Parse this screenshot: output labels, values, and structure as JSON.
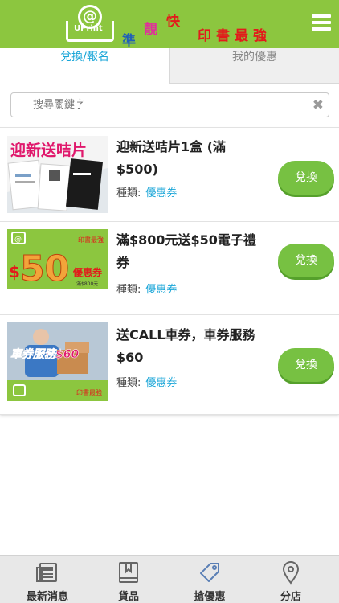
{
  "header": {
    "logo_text": "UPrint",
    "slogan": [
      "準",
      "靚",
      "快",
      "印書最強"
    ]
  },
  "tabs": [
    {
      "label": "兌換/報名",
      "active": true
    },
    {
      "label": "我的優惠",
      "active": false
    }
  ],
  "search": {
    "placeholder": "搜尋關鍵字",
    "value": ""
  },
  "offers": [
    {
      "title": "迎新送咭片1盒 (滿$500)",
      "type_label": "種類:",
      "type_value": "優惠券",
      "button": "兌換",
      "image_text": "迎新送咭片"
    },
    {
      "title": "滿$800元送$50電子禮券",
      "type_label": "種類:",
      "type_value": "優惠券",
      "button": "兌換",
      "image_text": {
        "amount": "$50",
        "label": "優惠券",
        "note": "滿$800元",
        "slogan": "印書最強"
      }
    },
    {
      "title": "送CALL車券，車券服務$60",
      "type_label": "種類:",
      "type_value": "優惠券",
      "button": "兌換",
      "image_text": {
        "main": "車券服務$60",
        "slogan": "印書最強"
      }
    }
  ],
  "bottom_nav": [
    {
      "label": "最新消息",
      "icon": "news-icon"
    },
    {
      "label": "貨品",
      "icon": "book-icon"
    },
    {
      "label": "搶優惠",
      "icon": "tag-icon"
    },
    {
      "label": "分店",
      "icon": "location-pin-icon"
    }
  ],
  "colors": {
    "brand_green": "#8cc63f",
    "button_green": "#77c142",
    "accent_blue": "#1aa6d8",
    "slogan_red": "#e21b1b"
  }
}
